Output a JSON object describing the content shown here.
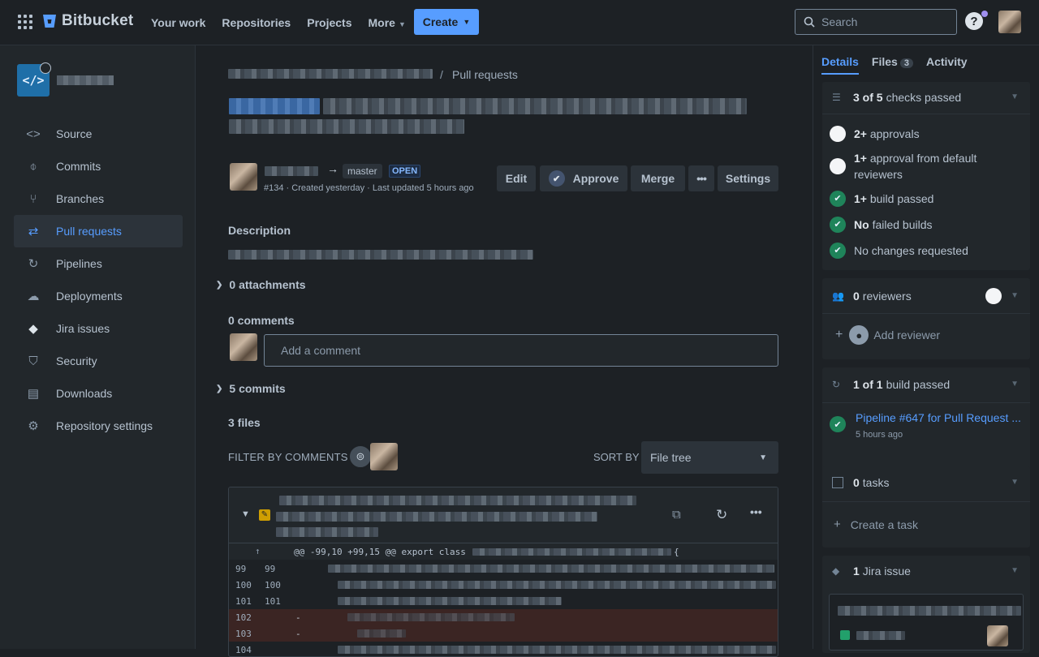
{
  "topbar": {
    "brand": "Bitbucket",
    "nav": [
      "Your work",
      "Repositories",
      "Projects",
      "More"
    ],
    "create": "Create",
    "search_placeholder": "Search",
    "help": "?"
  },
  "sidebar": {
    "items": [
      {
        "label": "Source",
        "icon": "code-icon"
      },
      {
        "label": "Commits",
        "icon": "commit-icon"
      },
      {
        "label": "Branches",
        "icon": "branch-icon"
      },
      {
        "label": "Pull requests",
        "icon": "pull-request-icon",
        "active": true
      },
      {
        "label": "Pipelines",
        "icon": "pipeline-icon"
      },
      {
        "label": "Deployments",
        "icon": "cloud-upload-icon"
      },
      {
        "label": "Jira issues",
        "icon": "jira-icon"
      },
      {
        "label": "Security",
        "icon": "shield-icon"
      },
      {
        "label": "Downloads",
        "icon": "document-icon"
      },
      {
        "label": "Repository settings",
        "icon": "gear-icon"
      }
    ]
  },
  "pr": {
    "breadcrumb_sep": "/",
    "breadcrumb_current": "Pull requests",
    "target_branch": "master",
    "status": "OPEN",
    "meta": "#134 · Created yesterday · Last updated 5 hours ago",
    "actions": {
      "edit": "Edit",
      "approve": "Approve",
      "merge": "Merge",
      "more": "•••",
      "settings": "Settings"
    },
    "description_label": "Description",
    "attachments": "0 attachments",
    "comments_label": "0 comments",
    "comment_placeholder": "Add a comment",
    "commits": "5 commits",
    "files": "3 files",
    "filter_label": "FILTER BY COMMENTS",
    "sort_label": "SORT BY",
    "sort_value": "File tree"
  },
  "diff": {
    "hunk": "@@ -99,10 +99,15 @@ export class",
    "rows": [
      {
        "old": "99",
        "new": "99",
        "sign": ""
      },
      {
        "old": "100",
        "new": "100",
        "sign": ""
      },
      {
        "old": "101",
        "new": "101",
        "sign": ""
      },
      {
        "old": "102",
        "new": "",
        "sign": "-"
      },
      {
        "old": "103",
        "new": "",
        "sign": "-"
      },
      {
        "old": "104",
        "new": "",
        "sign": ""
      }
    ]
  },
  "right": {
    "tabs": {
      "details": "Details",
      "files": "Files",
      "files_count": "3",
      "activity": "Activity"
    },
    "checks": {
      "bold": "3 of 5",
      "rest": "checks passed"
    },
    "check_items": [
      {
        "bold": "2+",
        "rest": "approvals",
        "state": "pending"
      },
      {
        "bold": "1+",
        "rest": "approval from default reviewers",
        "state": "pending"
      },
      {
        "bold": "1+",
        "rest": "build passed",
        "state": "passed"
      },
      {
        "bold": "No",
        "rest": "failed builds",
        "state": "passed"
      },
      {
        "bold": "",
        "rest": "No changes requested",
        "state": "passed"
      }
    ],
    "reviewers": {
      "bold": "0",
      "rest": "reviewers",
      "add": "Add reviewer"
    },
    "builds": {
      "bold": "1 of 1",
      "rest": "build passed",
      "pipeline": "Pipeline #647 for Pull Request ...",
      "time": "5 hours ago"
    },
    "tasks": {
      "bold": "0",
      "rest": "tasks",
      "create": "Create a task"
    },
    "jira": {
      "bold": "1",
      "rest": "Jira issue"
    }
  }
}
